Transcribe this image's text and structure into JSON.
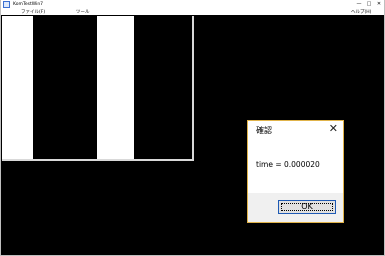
{
  "window": {
    "title": "KomTestWin7",
    "menu": [
      "ファイル(F)",
      "ツール",
      "ヘルプ(H)"
    ],
    "caption_buttons": [
      "—",
      "□",
      "✕"
    ]
  },
  "dialog": {
    "title": "確認",
    "message": "time = 0.000020",
    "ok_label": "OK",
    "close_glyph": "✕"
  },
  "colors": {
    "background": "#000000",
    "canvas": "#ffffff",
    "dialog_border": "#e0b34a",
    "button_focus": "#1e5ab4"
  }
}
